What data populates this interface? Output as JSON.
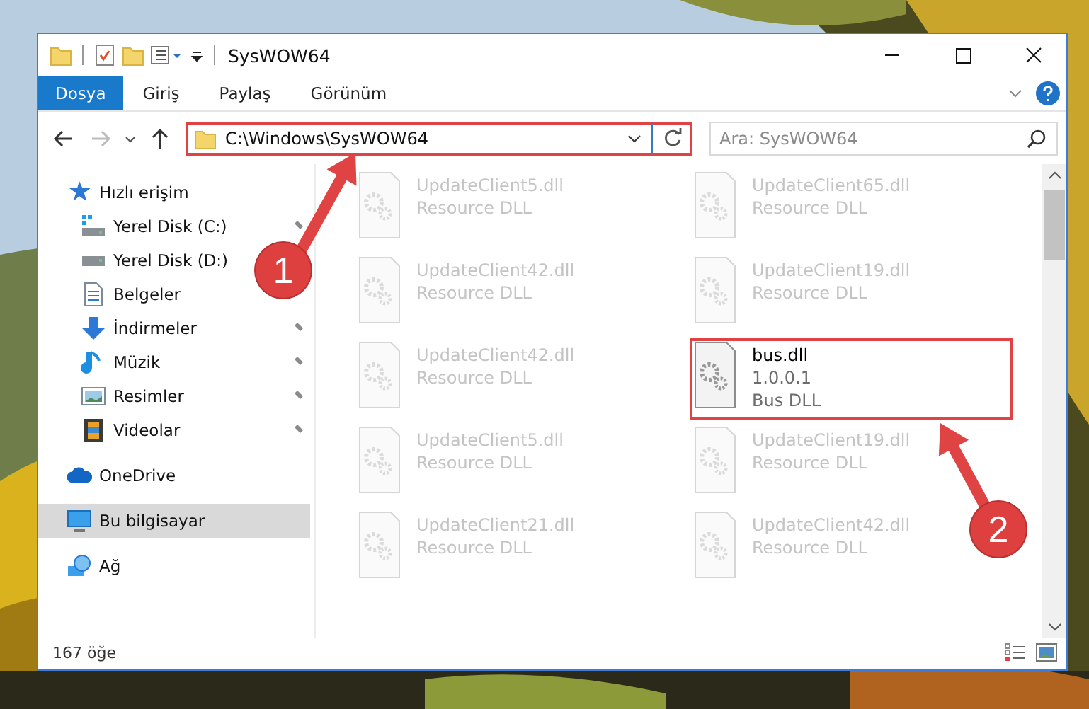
{
  "window": {
    "title": "SysWOW64"
  },
  "ribbon": {
    "tabs": [
      {
        "label": "Dosya",
        "selected": true
      },
      {
        "label": "Giriş",
        "selected": false
      },
      {
        "label": "Paylaş",
        "selected": false
      },
      {
        "label": "Görünüm",
        "selected": false
      }
    ]
  },
  "address": {
    "path": "C:\\Windows\\SysWOW64",
    "highlighted": true
  },
  "search": {
    "placeholder": "Ara: SysWOW64"
  },
  "sidebar": {
    "items": [
      {
        "label": "Hızlı erişim",
        "kind": "star",
        "selected": false,
        "children": [
          {
            "label": "Yerel Disk (C:)",
            "kind": "windrive",
            "pinned": true,
            "selected": false
          },
          {
            "label": "Yerel Disk (D:)",
            "kind": "drive",
            "selected": false
          },
          {
            "label": "Belgeler",
            "kind": "document",
            "selected": false
          },
          {
            "label": "İndirmeler",
            "kind": "download",
            "pinned": true,
            "selected": false
          },
          {
            "label": "Müzik",
            "kind": "music",
            "pinned": true,
            "selected": false
          },
          {
            "label": "Resimler",
            "pinned": true,
            "selected": false
          },
          {
            "label": "Videolar",
            "kind": "video",
            "pinned": true,
            "selected": false
          }
        ]
      },
      {
        "label": "OneDrive",
        "kind": "cloud",
        "selected": false
      },
      {
        "label": "Bu bilgisayar",
        "kind": "computer",
        "selected": true
      },
      {
        "label": "Ağ",
        "kind": "network",
        "selected": false
      }
    ]
  },
  "files": [
    {
      "name": "UpdateClient5.dll",
      "details": [
        "Resource DLL"
      ],
      "blurred": true,
      "highlighted": false
    },
    {
      "name": "UpdateClient65.dll",
      "details": [
        "Resource DLL"
      ],
      "blurred": true,
      "highlighted": false
    },
    {
      "name": "UpdateClient42.dll",
      "details": [
        "Resource DLL"
      ],
      "blurred": true,
      "highlighted": false
    },
    {
      "name": "UpdateClient19.dll",
      "details": [
        "Resource DLL"
      ],
      "blurred": true,
      "highlighted": false
    },
    {
      "name": "UpdateClient42.dll",
      "details": [
        "Resource DLL"
      ],
      "blurred": true,
      "highlighted": false
    },
    {
      "name": "bus.dll",
      "details": [
        "1.0.0.1",
        "Bus DLL"
      ],
      "blurred": false,
      "highlighted": true
    },
    {
      "name": "UpdateClient5.dll",
      "details": [
        "Resource DLL"
      ],
      "blurred": true,
      "highlighted": false
    },
    {
      "name": "UpdateClient19.dll",
      "details": [
        "Resource DLL"
      ],
      "blurred": true,
      "highlighted": false
    },
    {
      "name": "UpdateClient21.dll",
      "details": [
        "Resource DLL"
      ],
      "blurred": true,
      "highlighted": false
    },
    {
      "name": "UpdateClient42.dll",
      "details": [
        "Resource DLL"
      ],
      "blurred": true,
      "highlighted": false
    }
  ],
  "status_bar": {
    "count": "167 öğe"
  },
  "annotations": [
    {
      "number": "1"
    },
    {
      "number": "2"
    }
  ]
}
